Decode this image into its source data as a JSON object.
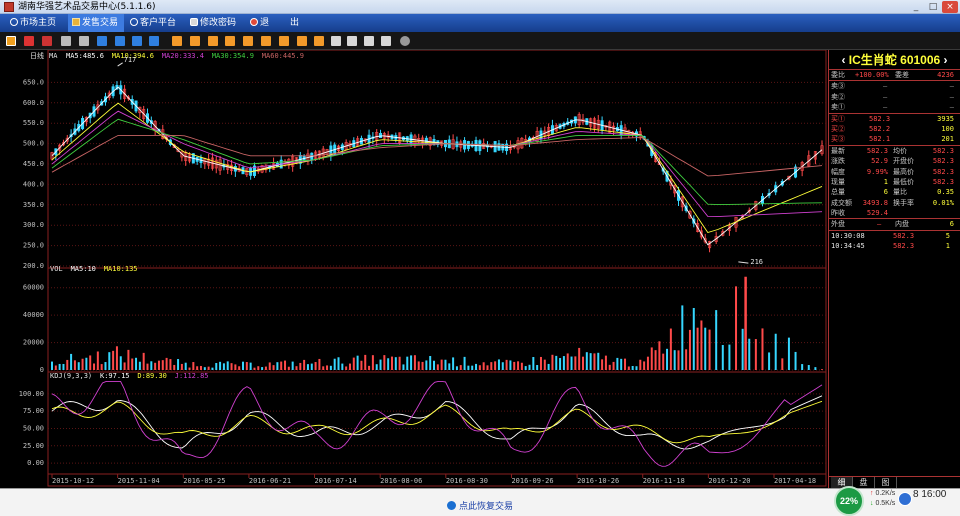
{
  "window": {
    "title": "湖南华强艺术品交易中心(5.1.1.6)"
  },
  "menu": {
    "items": [
      {
        "label": "市场主页",
        "icon": "home-icon"
      },
      {
        "label": "发售交易",
        "icon": "exchange-icon"
      },
      {
        "label": "客户平台",
        "icon": "client-icon"
      },
      {
        "label": "修改密码",
        "icon": "key-icon"
      },
      {
        "label": "退",
        "icon": "logout-icon"
      },
      {
        "label": "出",
        "icon": "none"
      }
    ]
  },
  "chart": {
    "period_label": "日线",
    "ma_label": "MA",
    "ma_legend": [
      {
        "label": "MA5:485.6",
        "color": "#ffffff"
      },
      {
        "label": "MA10:394.6",
        "color": "#ffff3a"
      },
      {
        "label": "MA20:333.4",
        "color": "#d040d0"
      },
      {
        "label": "MA30:354.9",
        "color": "#40d040"
      },
      {
        "label": "MA60:445.9",
        "color": "#c86464"
      }
    ],
    "high_label": "717",
    "low_label": "216",
    "vol_legend": [
      {
        "label": "VOL",
        "color": "#e0e0e0"
      },
      {
        "label": "MA5:10",
        "color": "#ffffff"
      },
      {
        "label": "MA10:135",
        "color": "#ffff3a"
      }
    ],
    "kdj_legend": [
      {
        "label": "KDJ(9,3,3)",
        "color": "#e0e0e0"
      },
      {
        "label": "K:97.15",
        "color": "#ffffff"
      },
      {
        "label": "D:89.30",
        "color": "#ffff3a"
      },
      {
        "label": "J:112.85",
        "color": "#d040d0"
      }
    ],
    "price_ticks": [
      "650.0",
      "600.0",
      "550.0",
      "500.0",
      "450.0",
      "400.0",
      "350.0",
      "300.0",
      "250.0",
      "200.0"
    ],
    "vol_ticks": [
      "60000",
      "40000",
      "20000",
      "0"
    ],
    "kdj_ticks": [
      "100.00",
      "75.00",
      "50.00",
      "25.00",
      "0.00"
    ],
    "date_ticks": [
      "2015-10-12",
      "2015-11-04",
      "2016-05-25",
      "2016-06-21",
      "2016-07-14",
      "2016-08-06",
      "2016-08-30",
      "2016-09-26",
      "2016-10-26",
      "2016-11-18",
      "2016-12-20",
      "2017-04-18"
    ]
  },
  "chart_data": [
    {
      "type": "line",
      "title": "日线",
      "ylim": [
        200,
        700
      ],
      "x": [
        "2015-10-12",
        "2015-11-04",
        "2016-05-25",
        "2016-06-21",
        "2016-07-14",
        "2016-08-06",
        "2016-08-30",
        "2016-09-26",
        "2016-10-26",
        "2016-11-18",
        "2016-12-20",
        "2017-04-18"
      ],
      "series": [
        {
          "name": "MA5:485.6",
          "values": [
            470,
            640,
            470,
            430,
            470,
            520,
            500,
            490,
            560,
            520,
            250,
            485
          ]
        },
        {
          "name": "MA10:394.6",
          "values": [
            460,
            600,
            480,
            430,
            460,
            510,
            500,
            495,
            540,
            520,
            280,
            395
          ]
        },
        {
          "name": "MA20:333.4",
          "values": [
            450,
            580,
            500,
            440,
            460,
            500,
            500,
            495,
            530,
            520,
            320,
            333
          ]
        },
        {
          "name": "MA30:354.9",
          "values": [
            440,
            560,
            510,
            450,
            460,
            495,
            500,
            495,
            520,
            520,
            350,
            355
          ]
        },
        {
          "name": "MA60:445.9",
          "values": [
            430,
            520,
            520,
            470,
            470,
            490,
            500,
            495,
            510,
            515,
            420,
            446
          ]
        }
      ]
    },
    {
      "type": "bar",
      "title": "VOL",
      "ylim": [
        0,
        70000
      ],
      "categories": [
        "2015-10-12",
        "2015-11-04",
        "2016-05-25",
        "2016-06-21",
        "2016-07-14",
        "2016-08-06",
        "2016-08-30",
        "2016-09-26",
        "2016-10-26",
        "2016-11-18",
        "2016-12-20",
        "2017-04-18"
      ],
      "values": [
        8000,
        15000,
        6000,
        5000,
        7000,
        10000,
        9000,
        6000,
        14000,
        6000,
        68000,
        500
      ]
    },
    {
      "type": "line",
      "title": "KDJ(9,3,3)",
      "ylim": [
        0,
        120
      ],
      "x": [
        "2015-10-12",
        "2015-11-04",
        "2016-05-25",
        "2016-06-21",
        "2016-07-14",
        "2016-08-06",
        "2016-08-30",
        "2016-09-26",
        "2016-10-26",
        "2016-11-18",
        "2016-12-20",
        "2017-04-18"
      ],
      "series": [
        {
          "name": "K:97.15",
          "values": [
            75,
            90,
            20,
            70,
            40,
            55,
            85,
            30,
            80,
            35,
            25,
            97.15
          ]
        },
        {
          "name": "D:89.30",
          "values": [
            70,
            80,
            35,
            60,
            45,
            55,
            75,
            40,
            70,
            45,
            30,
            89.3
          ]
        },
        {
          "name": "J:112.85",
          "values": [
            80,
            110,
            -5,
            95,
            30,
            60,
            105,
            10,
            100,
            15,
            10,
            112.85
          ]
        }
      ]
    }
  ],
  "quote": {
    "name": "IC生肖蛇",
    "code": "601006",
    "weibi_label": "委比",
    "weibi_value": "+100.00%",
    "weicha_label": "委差",
    "weicha_value": "4236",
    "sells": [
      {
        "label": "卖③",
        "price": "—",
        "vol": "—"
      },
      {
        "label": "卖②",
        "price": "—",
        "vol": "—"
      },
      {
        "label": "卖①",
        "price": "—",
        "vol": "—"
      }
    ],
    "buys": [
      {
        "label": "买①",
        "price": "582.3",
        "vol": "3935"
      },
      {
        "label": "买②",
        "price": "582.2",
        "vol": "100"
      },
      {
        "label": "买③",
        "price": "582.1",
        "vol": "201"
      }
    ],
    "stats": [
      {
        "l1": "最新",
        "v1": "582.3",
        "l2": "均价",
        "v2": "582.3"
      },
      {
        "l1": "涨跌",
        "v1": "52.9",
        "l2": "开盘价",
        "v2": "582.3"
      },
      {
        "l1": "幅度",
        "v1": "9.99%",
        "l2": "最高价",
        "v2": "582.3"
      },
      {
        "l1": "现量",
        "v1": "1",
        "l2": "最低价",
        "v2": "582.3"
      },
      {
        "l1": "总量",
        "v1": "6",
        "l2": "量比",
        "v2": "0.35"
      },
      {
        "l1": "成交额",
        "v1": "3493.8",
        "l2": "换手率",
        "v2": "0.01%"
      },
      {
        "l1": "昨收",
        "v1": "529.4",
        "l2": "",
        "v2": ""
      }
    ],
    "outer_label": "外盘",
    "outer_value": "—",
    "inner_label": "内盘",
    "inner_value": "6",
    "ticks": [
      {
        "time": "10:30:08",
        "price": "582.3",
        "vol": "5"
      },
      {
        "time": "10:34:45",
        "price": "582.3",
        "vol": "1"
      }
    ],
    "tabs": [
      "细",
      "盘",
      "图"
    ]
  },
  "status": {
    "restore_label": "点此恢复交易",
    "clock": "8 16:00",
    "net_percent": "22%",
    "up_speed": "0.2K/s",
    "down_speed": "0.5K/s"
  }
}
